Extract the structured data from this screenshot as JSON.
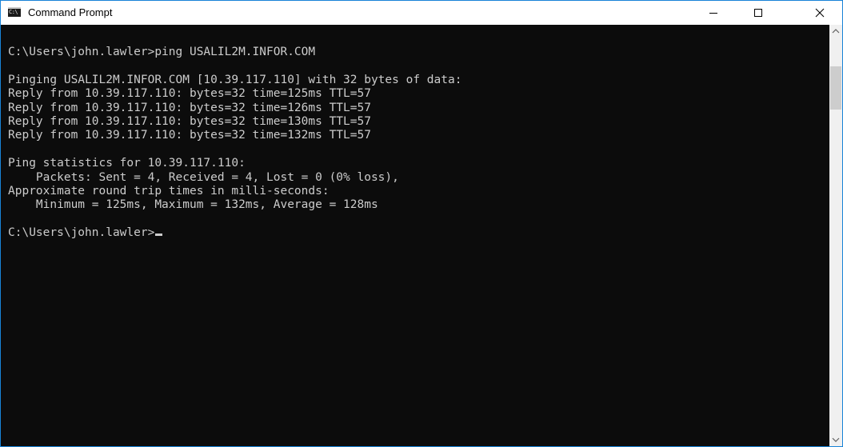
{
  "window": {
    "title": "Command Prompt",
    "app_icon_text": "C:\\",
    "app_icon": "cmd-icon"
  },
  "controls": {
    "minimize_icon": "minimize-icon",
    "maximize_icon": "maximize-icon",
    "close_icon": "close-icon"
  },
  "console": {
    "lines": [
      "C:\\Users\\john.lawler>ping USALIL2M.INFOR.COM",
      "",
      "Pinging USALIL2M.INFOR.COM [10.39.117.110] with 32 bytes of data:",
      "Reply from 10.39.117.110: bytes=32 time=125ms TTL=57",
      "Reply from 10.39.117.110: bytes=32 time=126ms TTL=57",
      "Reply from 10.39.117.110: bytes=32 time=130ms TTL=57",
      "Reply from 10.39.117.110: bytes=32 time=132ms TTL=57",
      "",
      "Ping statistics for 10.39.117.110:",
      "    Packets: Sent = 4, Received = 4, Lost = 0 (0% loss),",
      "Approximate round trip times in milli-seconds:",
      "    Minimum = 125ms, Maximum = 132ms, Average = 128ms",
      "",
      "C:\\Users\\john.lawler>"
    ],
    "foreground": "#cccccc",
    "background": "#0c0c0c"
  },
  "scrollbar": {
    "up_icon": "scroll-up-arrow-icon",
    "down_icon": "scroll-down-arrow-icon"
  },
  "colors": {
    "accent_border": "#1883d7",
    "titlebar_bg": "#ffffff"
  }
}
